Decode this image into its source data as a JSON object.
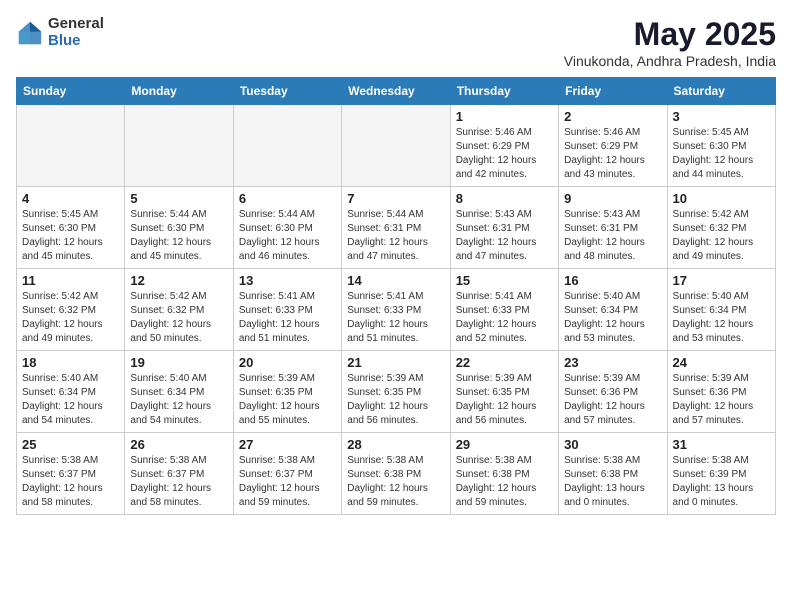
{
  "logo": {
    "general": "General",
    "blue": "Blue"
  },
  "title": {
    "month": "May 2025",
    "location": "Vinukonda, Andhra Pradesh, India"
  },
  "headers": [
    "Sunday",
    "Monday",
    "Tuesday",
    "Wednesday",
    "Thursday",
    "Friday",
    "Saturday"
  ],
  "weeks": [
    [
      {
        "day": "",
        "info": ""
      },
      {
        "day": "",
        "info": ""
      },
      {
        "day": "",
        "info": ""
      },
      {
        "day": "",
        "info": ""
      },
      {
        "day": "1",
        "info": "Sunrise: 5:46 AM\nSunset: 6:29 PM\nDaylight: 12 hours\nand 42 minutes."
      },
      {
        "day": "2",
        "info": "Sunrise: 5:46 AM\nSunset: 6:29 PM\nDaylight: 12 hours\nand 43 minutes."
      },
      {
        "day": "3",
        "info": "Sunrise: 5:45 AM\nSunset: 6:30 PM\nDaylight: 12 hours\nand 44 minutes."
      }
    ],
    [
      {
        "day": "4",
        "info": "Sunrise: 5:45 AM\nSunset: 6:30 PM\nDaylight: 12 hours\nand 45 minutes."
      },
      {
        "day": "5",
        "info": "Sunrise: 5:44 AM\nSunset: 6:30 PM\nDaylight: 12 hours\nand 45 minutes."
      },
      {
        "day": "6",
        "info": "Sunrise: 5:44 AM\nSunset: 6:30 PM\nDaylight: 12 hours\nand 46 minutes."
      },
      {
        "day": "7",
        "info": "Sunrise: 5:44 AM\nSunset: 6:31 PM\nDaylight: 12 hours\nand 47 minutes."
      },
      {
        "day": "8",
        "info": "Sunrise: 5:43 AM\nSunset: 6:31 PM\nDaylight: 12 hours\nand 47 minutes."
      },
      {
        "day": "9",
        "info": "Sunrise: 5:43 AM\nSunset: 6:31 PM\nDaylight: 12 hours\nand 48 minutes."
      },
      {
        "day": "10",
        "info": "Sunrise: 5:42 AM\nSunset: 6:32 PM\nDaylight: 12 hours\nand 49 minutes."
      }
    ],
    [
      {
        "day": "11",
        "info": "Sunrise: 5:42 AM\nSunset: 6:32 PM\nDaylight: 12 hours\nand 49 minutes."
      },
      {
        "day": "12",
        "info": "Sunrise: 5:42 AM\nSunset: 6:32 PM\nDaylight: 12 hours\nand 50 minutes."
      },
      {
        "day": "13",
        "info": "Sunrise: 5:41 AM\nSunset: 6:33 PM\nDaylight: 12 hours\nand 51 minutes."
      },
      {
        "day": "14",
        "info": "Sunrise: 5:41 AM\nSunset: 6:33 PM\nDaylight: 12 hours\nand 51 minutes."
      },
      {
        "day": "15",
        "info": "Sunrise: 5:41 AM\nSunset: 6:33 PM\nDaylight: 12 hours\nand 52 minutes."
      },
      {
        "day": "16",
        "info": "Sunrise: 5:40 AM\nSunset: 6:34 PM\nDaylight: 12 hours\nand 53 minutes."
      },
      {
        "day": "17",
        "info": "Sunrise: 5:40 AM\nSunset: 6:34 PM\nDaylight: 12 hours\nand 53 minutes."
      }
    ],
    [
      {
        "day": "18",
        "info": "Sunrise: 5:40 AM\nSunset: 6:34 PM\nDaylight: 12 hours\nand 54 minutes."
      },
      {
        "day": "19",
        "info": "Sunrise: 5:40 AM\nSunset: 6:34 PM\nDaylight: 12 hours\nand 54 minutes."
      },
      {
        "day": "20",
        "info": "Sunrise: 5:39 AM\nSunset: 6:35 PM\nDaylight: 12 hours\nand 55 minutes."
      },
      {
        "day": "21",
        "info": "Sunrise: 5:39 AM\nSunset: 6:35 PM\nDaylight: 12 hours\nand 56 minutes."
      },
      {
        "day": "22",
        "info": "Sunrise: 5:39 AM\nSunset: 6:35 PM\nDaylight: 12 hours\nand 56 minutes."
      },
      {
        "day": "23",
        "info": "Sunrise: 5:39 AM\nSunset: 6:36 PM\nDaylight: 12 hours\nand 57 minutes."
      },
      {
        "day": "24",
        "info": "Sunrise: 5:39 AM\nSunset: 6:36 PM\nDaylight: 12 hours\nand 57 minutes."
      }
    ],
    [
      {
        "day": "25",
        "info": "Sunrise: 5:38 AM\nSunset: 6:37 PM\nDaylight: 12 hours\nand 58 minutes."
      },
      {
        "day": "26",
        "info": "Sunrise: 5:38 AM\nSunset: 6:37 PM\nDaylight: 12 hours\nand 58 minutes."
      },
      {
        "day": "27",
        "info": "Sunrise: 5:38 AM\nSunset: 6:37 PM\nDaylight: 12 hours\nand 59 minutes."
      },
      {
        "day": "28",
        "info": "Sunrise: 5:38 AM\nSunset: 6:38 PM\nDaylight: 12 hours\nand 59 minutes."
      },
      {
        "day": "29",
        "info": "Sunrise: 5:38 AM\nSunset: 6:38 PM\nDaylight: 12 hours\nand 59 minutes."
      },
      {
        "day": "30",
        "info": "Sunrise: 5:38 AM\nSunset: 6:38 PM\nDaylight: 13 hours\nand 0 minutes."
      },
      {
        "day": "31",
        "info": "Sunrise: 5:38 AM\nSunset: 6:39 PM\nDaylight: 13 hours\nand 0 minutes."
      }
    ]
  ]
}
